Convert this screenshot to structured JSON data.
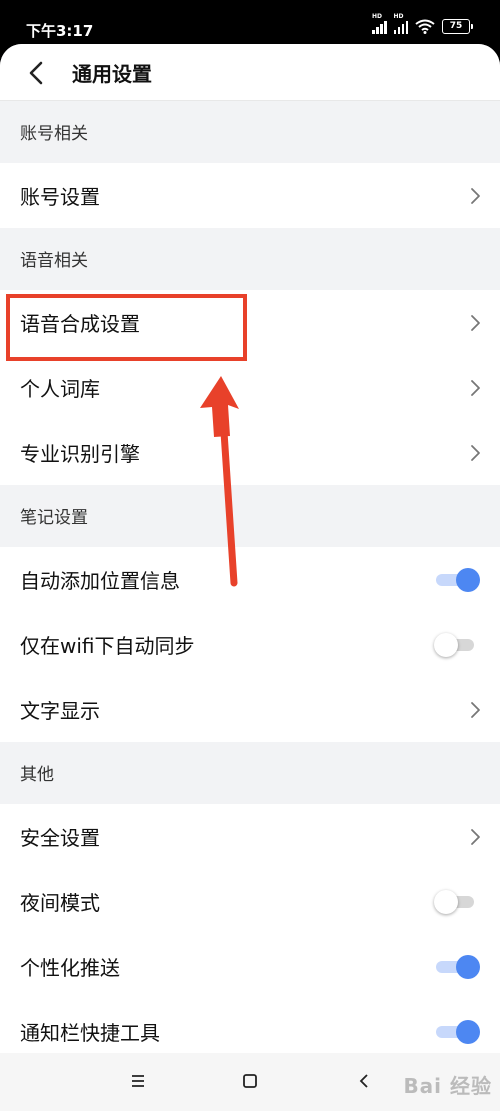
{
  "status_bar": {
    "time": "下午3:17",
    "battery": "75",
    "signal_label": "HD"
  },
  "header": {
    "title": "通用设置"
  },
  "sections": [
    {
      "label": "账号相关",
      "items": [
        {
          "label": "账号设置",
          "control": "chevron"
        }
      ]
    },
    {
      "label": "语音相关",
      "items": [
        {
          "label": "语音合成设置",
          "control": "chevron"
        },
        {
          "label": "个人词库",
          "control": "chevron"
        },
        {
          "label": "专业识别引擎",
          "control": "chevron"
        }
      ]
    },
    {
      "label": "笔记设置",
      "items": [
        {
          "label": "自动添加位置信息",
          "control": "toggle",
          "on": true
        },
        {
          "label": "仅在wifi下自动同步",
          "control": "toggle",
          "on": false
        },
        {
          "label": "文字显示",
          "control": "chevron"
        }
      ]
    },
    {
      "label": "其他",
      "items": [
        {
          "label": "安全设置",
          "control": "chevron"
        },
        {
          "label": "夜间模式",
          "control": "toggle",
          "on": false
        },
        {
          "label": "个性化推送",
          "control": "toggle",
          "on": true
        },
        {
          "label": "通知栏快捷工具",
          "control": "toggle",
          "on": true
        }
      ]
    }
  ],
  "nav_bar": {
    "icons": [
      "menu-icon",
      "home-icon",
      "back-icon"
    ],
    "watermark": "Bai 经验"
  },
  "annotation": {
    "highlight_color": "#e8412a",
    "highlighted_item": "语音合成设置"
  },
  "colors": {
    "toggle_on": "#4d87f2",
    "background": "#f2f3f5"
  }
}
